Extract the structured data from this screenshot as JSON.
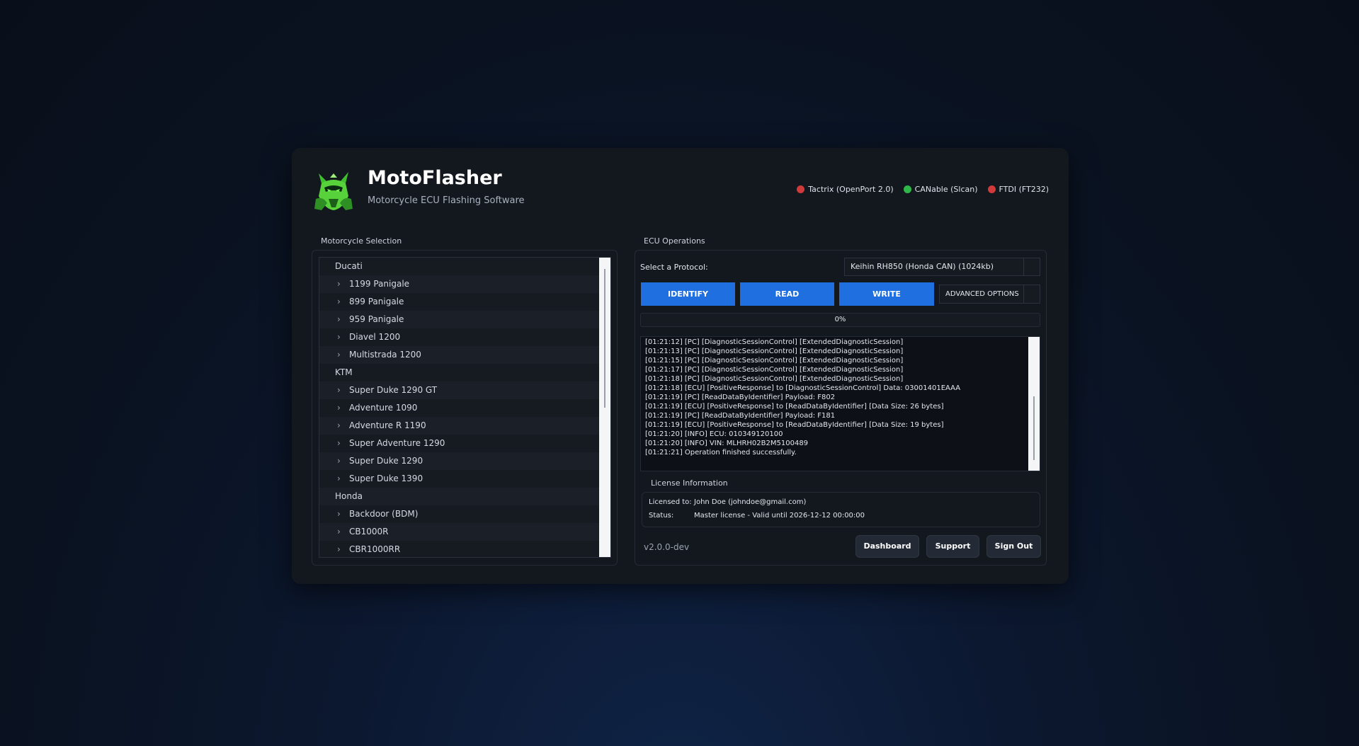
{
  "header": {
    "title": "MotoFlasher",
    "subtitle": "Motorcycle ECU Flashing Software",
    "devices": [
      {
        "label": "Tactrix (OpenPort 2.0)",
        "color": "#d03a3a"
      },
      {
        "label": "CANable (Slcan)",
        "color": "#2fb84a"
      },
      {
        "label": "FTDI (FT232)",
        "color": "#d03a3a"
      }
    ]
  },
  "motorcycle_selection": {
    "label": "Motorcycle Selection",
    "tree": [
      {
        "type": "group",
        "label": "Ducati"
      },
      {
        "type": "child",
        "label": "1199 Panigale"
      },
      {
        "type": "child",
        "label": "899 Panigale"
      },
      {
        "type": "child",
        "label": "959 Panigale"
      },
      {
        "type": "child",
        "label": "Diavel 1200"
      },
      {
        "type": "child",
        "label": "Multistrada 1200"
      },
      {
        "type": "group",
        "label": "KTM"
      },
      {
        "type": "child",
        "label": "Super Duke 1290 GT"
      },
      {
        "type": "child",
        "label": "Adventure 1090"
      },
      {
        "type": "child",
        "label": "Adventure R 1190"
      },
      {
        "type": "child",
        "label": "Super Adventure 1290"
      },
      {
        "type": "child",
        "label": "Super Duke 1290"
      },
      {
        "type": "child",
        "label": "Super Duke 1390"
      },
      {
        "type": "group",
        "label": "Honda"
      },
      {
        "type": "child",
        "label": "Backdoor (BDM)"
      },
      {
        "type": "child",
        "label": "CB1000R"
      },
      {
        "type": "child",
        "label": "CBR1000RR"
      }
    ]
  },
  "ecu_operations": {
    "label": "ECU Operations",
    "protocol_label": "Select a Protocol:",
    "protocol_value": "Keihin RH850 (Honda CAN) (1024kb)",
    "buttons": {
      "identify": "IDENTIFY",
      "read": "READ",
      "write": "WRITE",
      "advanced": "ADVANCED OPTIONS"
    },
    "progress": {
      "text": "0%",
      "value": 0
    },
    "log": [
      "[01:21:12] [PC] [DiagnosticSessionControl] [ExtendedDiagnosticSession]",
      "[01:21:13] [PC] [DiagnosticSessionControl] [ExtendedDiagnosticSession]",
      "[01:21:15] [PC] [DiagnosticSessionControl] [ExtendedDiagnosticSession]",
      "[01:21:17] [PC] [DiagnosticSessionControl] [ExtendedDiagnosticSession]",
      "[01:21:18] [PC] [DiagnosticSessionControl] [ExtendedDiagnosticSession]",
      "[01:21:18] [ECU] [PositiveResponse] to [DiagnosticSessionControl] Data: 03001401EAAA",
      "[01:21:19] [PC] [ReadDataByIdentifier] Payload: F802",
      "[01:21:19] [ECU] [PositiveResponse] to [ReadDataByIdentifier] [Data Size: 26 bytes]",
      "[01:21:19] [PC] [ReadDataByIdentifier] Payload: F181",
      "[01:21:19] [ECU] [PositiveResponse] to [ReadDataByIdentifier] [Data Size: 19 bytes]",
      "[01:21:20] [INFO] ECU: 010349120100",
      "[01:21:20] [INFO] VIN: MLHRH02B2M5100489",
      "[01:21:21] Operation finished successfully."
    ]
  },
  "license": {
    "label": "License Information",
    "licensed_to_key": "Licensed to:",
    "licensed_to_value": "John Doe (johndoe@gmail.com)",
    "status_key": "Status:",
    "status_value": "Master license - Valid until 2026-12-12 00:00:00"
  },
  "footer": {
    "version": "v2.0.0-dev",
    "dashboard": "Dashboard",
    "support": "Support",
    "sign_out": "Sign Out"
  }
}
